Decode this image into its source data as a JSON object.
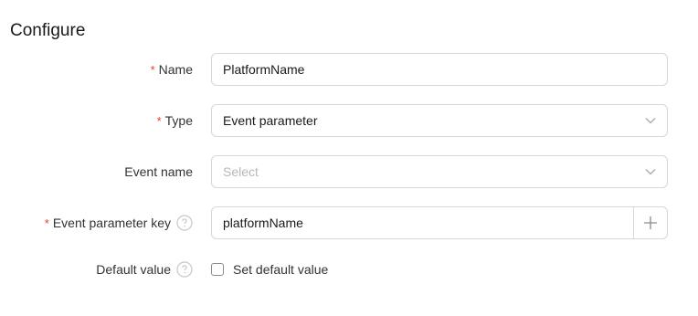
{
  "section": {
    "title": "Configure"
  },
  "form": {
    "name": {
      "label": "Name",
      "required_mark": "*",
      "value": "PlatformName"
    },
    "type": {
      "label": "Type",
      "required_mark": "*",
      "value": "Event parameter",
      "icon": "chevron-down-icon"
    },
    "event_name": {
      "label": "Event name",
      "placeholder": "Select",
      "icon": "chevron-down-icon"
    },
    "event_parameter_key": {
      "label": "Event parameter key",
      "required_mark": "*",
      "value": "platformName",
      "help_icon": "question-circle-icon",
      "add_icon": "plus-icon"
    },
    "default_value": {
      "label": "Default value",
      "help_icon": "question-circle-icon",
      "checkbox_label": "Set default value",
      "checked": false
    }
  },
  "colors": {
    "required": "#e84026",
    "border": "#d6d6d6",
    "text": "#191919",
    "placeholder": "#b8b8b8",
    "icon": "#a6a6a6"
  }
}
